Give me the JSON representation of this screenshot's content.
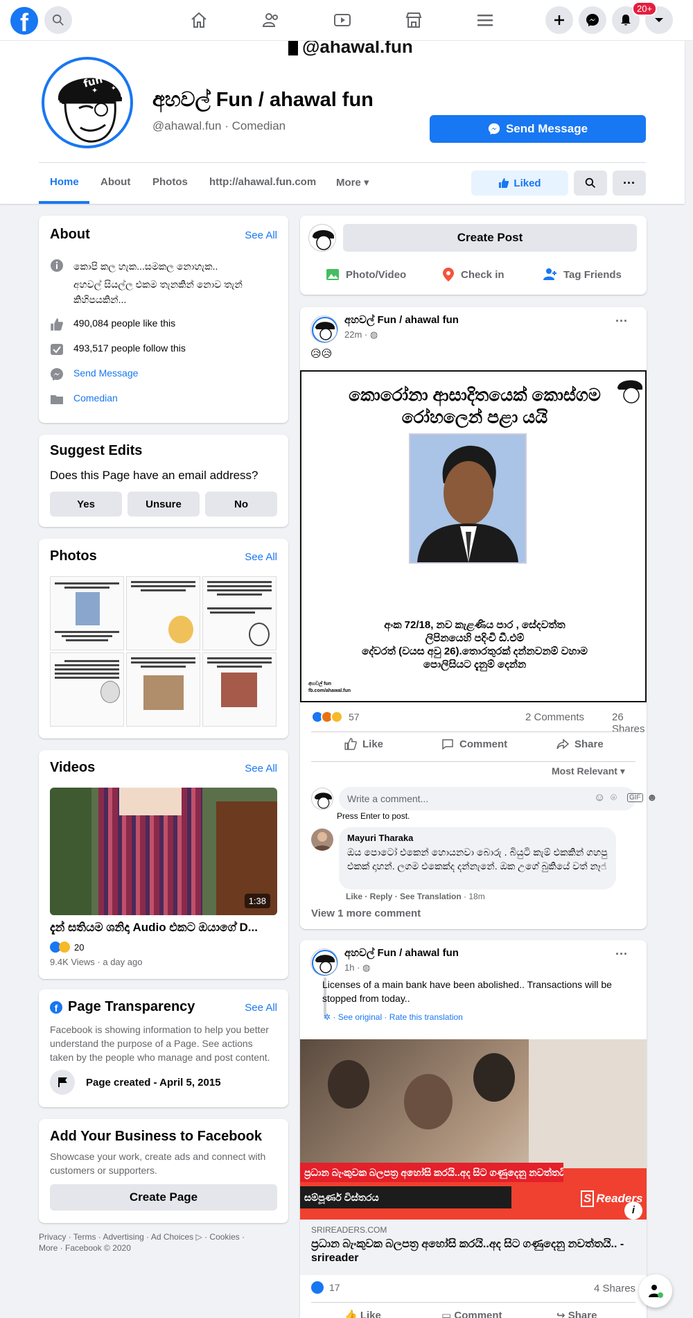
{
  "page": {
    "name": "අහවල් Fun / ahawal fun",
    "handle": "@ahawal.fun",
    "category": "Comedian",
    "cover_caption": "@ahawal.fun",
    "profile_art_text": "අහවල් fun"
  },
  "topbar": {
    "notification_count": "20+"
  },
  "header": {
    "send_message": "Send Message"
  },
  "tabs": {
    "home": "Home",
    "about": "About",
    "photos": "Photos",
    "website": "http://ahawal.fun.com",
    "more": "More",
    "liked": "Liked"
  },
  "about": {
    "title": "About",
    "see_all": "See All",
    "description1": "කොපි කල හැක...සමකල නොහැක..",
    "description2": "අහවල් සියල්ල එකම තැනකින් නොව තැන් කිහිපයකින්...",
    "likes": "490,084 people like this",
    "follows": "493,517 people follow this",
    "message": "Send Message",
    "category": "Comedian"
  },
  "suggest": {
    "title": "Suggest Edits",
    "question": "Does this Page have an email address?",
    "yes": "Yes",
    "unsure": "Unsure",
    "no": "No"
  },
  "photos": {
    "title": "Photos",
    "see_all": "See All"
  },
  "videos": {
    "title": "Videos",
    "see_all": "See All",
    "duration": "1:38",
    "video_title": "දැන් සතියම ශනිදා Audio එකට ඔයාගේ D...",
    "reactions": "20",
    "meta": "9.4K Views · a day ago"
  },
  "transparency": {
    "title": "Page Transparency",
    "see_all": "See All",
    "text": "Facebook is showing information to help you better understand the purpose of a Page. See actions taken by the people who manage and post content.",
    "created": "Page created - April 5, 2015"
  },
  "business": {
    "title": "Add Your Business to Facebook",
    "text": "Showcase your work, create ads and connect with customers or supporters.",
    "button": "Create Page"
  },
  "footer": {
    "line1": "Privacy · Terms · Advertising · Ad Choices ▷ · Cookies ·",
    "line2": "More · Facebook © 2020"
  },
  "composer": {
    "create_post": "Create Post",
    "photo_video": "Photo/Video",
    "check_in": "Check in",
    "tag_friends": "Tag Friends"
  },
  "post1": {
    "author": "අහවල් Fun / ahawal fun",
    "time": "22m · ",
    "emoji": "😥😥",
    "img_title1": "කොරෝනා ආසාදිතයෙක් කොස්ගම",
    "img_title2": "රෝහලෙන් පළා යයි",
    "img_body1": "අංක 72/18, නව කැළණිය පාර , සේදවත්ත",
    "img_body2": "ලිපිනයෙහි පදිංචි ඩී.එම්",
    "img_body3": "දේවරත් (වයස අවු 26).තොරතුරක් දන්නවනම් වහාම",
    "img_body4": "පොලිසියට දැනුම් දෙන්න",
    "img_footer1": "අහවල් fun",
    "img_footer2": "fb.com/ahawal.fun",
    "reactions": "57",
    "comments": "2 Comments",
    "shares": "26 Shares",
    "like": "Like",
    "comment": "Comment",
    "share": "Share",
    "most_relevant": "Most Relevant",
    "write_comment": "Write a comment...",
    "press_enter": "Press Enter to post.",
    "commenter": "Mayuri Tharaka",
    "comment_text": "ඔය ‍පොටෝ එකෙන් හොයනවා බොරු . බියුටි කැම් එකකින් ගහපු එකක් දාහන්. ලගම එකෙක්ද දන්නැනේ. ඔක උගේ බුකියේ වත් නෑ☝",
    "comment_actions": "Like · Reply · See Translation",
    "comment_time": " · 18m",
    "view_more": "View 1 more comment"
  },
  "post2": {
    "author": "අහවල් Fun / ahawal fun",
    "time": "1h · ",
    "text": "Licenses of a main bank have been abolished.. Transactions will be stopped from today..",
    "see_original": "· See original · Rate this translation",
    "banner": "ප්‍රධාන බැංකුවක බලපත්‍ර අහෝසි කරයි..අද සිට ගණුදෙනු නවත්තයි",
    "banner2": "සම්පූර්ණ විස්තරය",
    "source_logo": "Readers",
    "domain": "SRIREADERS.COM",
    "link_title": "ප්‍රධාන බැංකුවක බලපත්‍ර අහෝසි කරයි..අද සිට ගණුදෙනු නවත්තයි.. - srireader",
    "reactions": "17",
    "shares": "4 Shares",
    "like": "Like",
    "comment": "Comment",
    "share": "Share"
  },
  "colors": {
    "brand": "#1877f2",
    "bg": "#f0f2f5",
    "muted": "#65676b"
  }
}
